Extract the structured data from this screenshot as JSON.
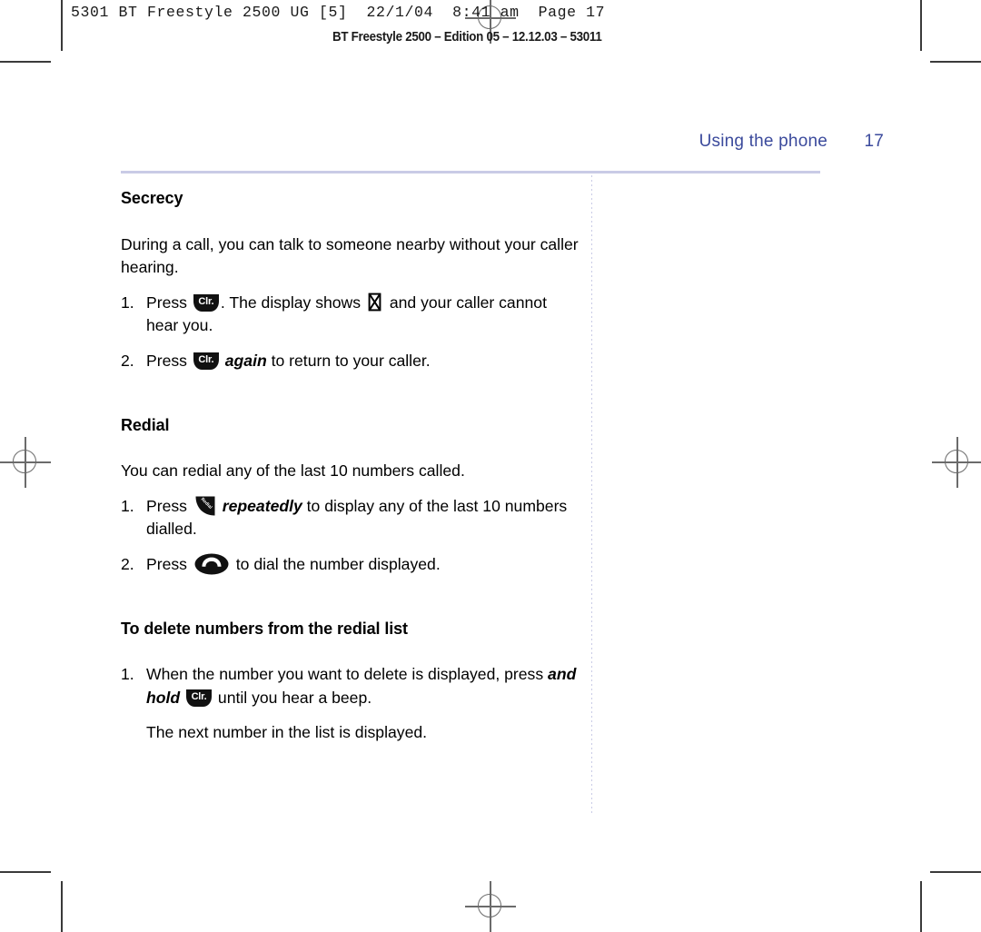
{
  "prepress": {
    "slug_line": "5301 BT Freestyle 2500 UG [5]  22/1/04  8:41 am  Page 17",
    "edition_line": "BT Freestyle 2500 – Edition 05 – 12.12.03 – 53011"
  },
  "running_head": {
    "chapter": "Using the phone",
    "page_number": "17",
    "color": "#3b4a9c"
  },
  "sections": [
    {
      "heading": "Secrecy",
      "intro": "During a call, you can talk to someone nearby without your caller hearing.",
      "steps": [
        {
          "number": "1.",
          "text_before": "Press ",
          "key": "Clr.",
          "text_middle": ". The display shows ",
          "symbol": "mute-symbol",
          "text_after": " and your caller cannot hear you."
        },
        {
          "number": "2.",
          "text_before": "Press ",
          "key": "Clr.",
          "emphasis": "again",
          "text_after": " to return to your caller."
        }
      ]
    },
    {
      "heading": "Redial",
      "intro": "You can redial any of the last 10 numbers called.",
      "steps": [
        {
          "number": "1.",
          "text_before": "Press ",
          "key": "Redial",
          "emphasis": "repeatedly",
          "text_after": " to display any of the last 10 numbers dialled."
        },
        {
          "number": "2.",
          "text_before": "Press ",
          "key": "dial-handset",
          "text_after": " to dial the number displayed."
        }
      ]
    },
    {
      "heading": "To delete numbers from the redial list",
      "steps": [
        {
          "number": "1.",
          "text_before": "When the number you want to delete is displayed, press ",
          "emphasis": "and hold",
          "key": "Clr.",
          "text_after": " until you hear a beep."
        }
      ],
      "closing": "The next number in the list is displayed."
    }
  ],
  "keycaps": {
    "clr_label": "Clr.",
    "redial_label": "Redial"
  },
  "colors": {
    "accent": "#3b4a9c",
    "rule": "#c9cbe6",
    "key_fill": "#111111",
    "crop_mark": "#3a3a3a",
    "reg_mark": "#6b6b6b"
  }
}
